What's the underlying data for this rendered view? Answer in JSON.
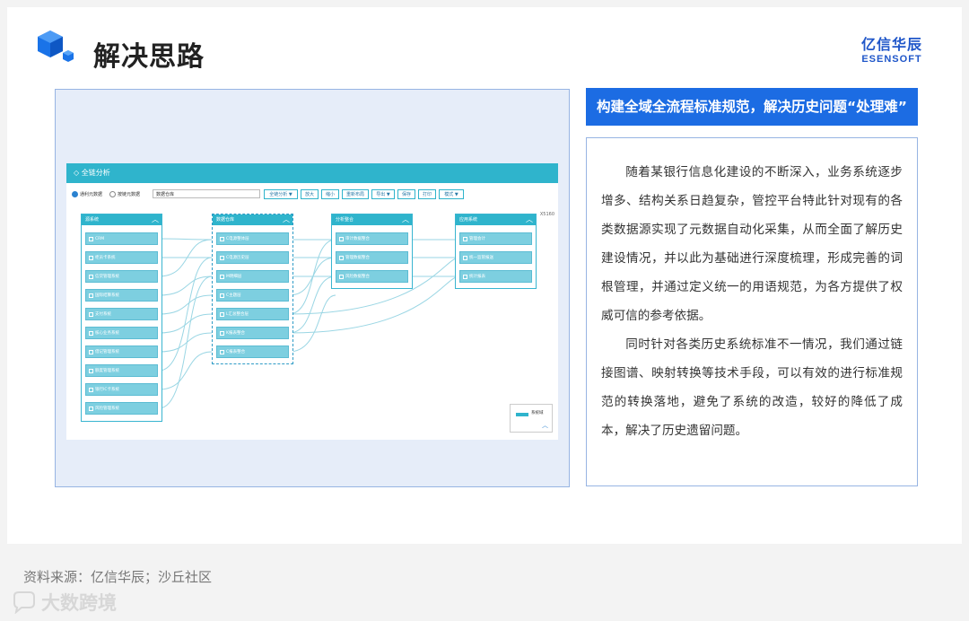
{
  "header": {
    "title": "解决思路",
    "brand_cn": "亿信华辰",
    "brand_en": "ESENSOFT"
  },
  "screenshot": {
    "app_title": "全链分析",
    "radio_1": "通利元数据",
    "radio_2": "按链元数据",
    "search_value": "数据仓库",
    "buttons": [
      "全链分析 ▼",
      "放大",
      "缩小",
      "重新布局",
      "导出 ▼",
      "保存",
      "打印",
      "模式 ▼"
    ],
    "coord_text": "X5160",
    "panes": [
      {
        "title": "源系统",
        "nodes": [
          "CRM",
          "柜员卡系统",
          "信贷管理系统",
          "国际结算系统",
          "支付系统",
          "核心业务系统",
          "借记管理系统",
          "额度管理系统",
          "银行IC卡系统",
          "风险管理系统"
        ]
      },
      {
        "title": "数据仓库",
        "nodes": [
          "C电源整体层",
          "C电源历史层",
          "M明细层",
          "C主题层",
          "L汇总整合层",
          "K报表整合",
          "C报表整合"
        ]
      },
      {
        "title": "分析整合",
        "nodes": [
          "审计数据整合",
          "管理数据整合",
          "风险数据整合"
        ]
      },
      {
        "title": "应用系统",
        "nodes": [
          "管理会计",
          "统一监管报送",
          "统计报表"
        ]
      }
    ],
    "legend_label": "系统域"
  },
  "banner": "构建全域全流程标准规范，解决历史问题“处理难”",
  "paragraphs": [
    "随着某银行信息化建设的不断深入，业务系统逐步增多、结构关系日趋复杂，管控平台特此针对现有的各类数据源实现了元数据自动化采集，从而全面了解历史建设情况，并以此为基础进行深度梳理，形成完善的词根管理，并通过定义统一的用语规范，为各方提供了权威可信的参考依据。",
    "同时针对各类历史系统标准不一情况，我们通过链接图谱、映射转换等技术手段，可以有效的进行标准规范的转换落地，避免了系统的改造，较好的降低了成本，解决了历史遗留问题。"
  ],
  "footer": {
    "source": "资料来源：亿信华辰；沙丘社区",
    "watermark": "大数跨境"
  }
}
